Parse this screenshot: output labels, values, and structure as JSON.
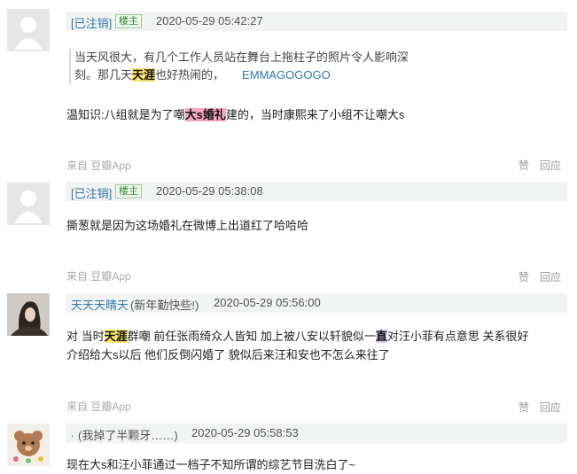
{
  "comments": [
    {
      "author": "[已注销]",
      "badge": "楼主",
      "time": "2020-05-29 05:42:27",
      "quote": {
        "line1": "当天风很大，有几个工作人员站在舞台上拖柱子的照片令人影响深",
        "line2_pre": "刻。那几天",
        "line2_hl": "天涯",
        "line2_post": "也好热闹的，",
        "author": "EMMAGOGOGO"
      },
      "text_pre": "温知识:八组就是为了嘲",
      "text_hl": "大s婚礼",
      "text_post": "建的，当时康熙来了小组不让嘲大s",
      "source": "来自 豆瓣App",
      "like": "赞",
      "reply": "回应"
    },
    {
      "author": "[已注销]",
      "badge": "楼主",
      "time": "2020-05-29 05:38:08",
      "text": "撕葱就是因为这场婚礼在微博上出道红了哈哈哈",
      "source": "来自 豆瓣App",
      "like": "赞",
      "reply": "回应"
    },
    {
      "author": "天天天晴天",
      "status": "(新年勤快些!)",
      "time": "2020-05-29 05:56:00",
      "line1_a": "对 当时",
      "line1_hl1": "天涯",
      "line1_b": "群嘲 前任张雨绮众人皆知 加上被八安以轩貌似一",
      "line1_hl2": "直",
      "line1_c": "对汪小菲有点意思 关系很好",
      "line2": "介绍给大s以后 他们反倒闪婚了 貌似后来汪和安也不怎么来往了",
      "source": "来自 豆瓣App",
      "like": "赞",
      "reply": "回应"
    },
    {
      "author": ".",
      "status": "(我掉了半颗牙……)",
      "time": "2020-05-29 05:58:53",
      "text": "现在大s和汪小菲通过一档子不知所谓的综艺节目洗白了~"
    }
  ],
  "colors": {
    "link": "#3377aa",
    "header_bg": "#f0f3f1",
    "highlight_yellow": "#fde56e",
    "highlight_pink": "#f7a8c3"
  },
  "icons": [
    "default-avatar-icon",
    "user-photo-avatar",
    "bear-sticker-avatar"
  ]
}
